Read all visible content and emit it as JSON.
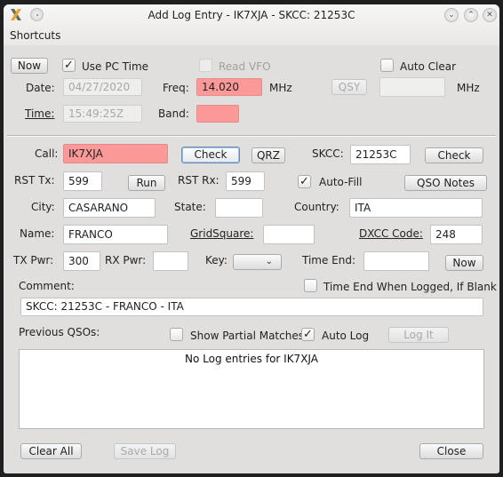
{
  "window": {
    "title": "Add Log Entry - IK7XJA - SKCC: 21253C",
    "icons": {
      "app": "x-app-icon",
      "pin": "pin-icon",
      "minimize": "chevron-down-icon",
      "maximize": "chevron-up-icon",
      "close": "close-icon"
    },
    "minimize_glyph": "⌄",
    "maximize_glyph": "⌃",
    "close_glyph": "✕"
  },
  "menu": {
    "items": [
      "Shortcuts"
    ]
  },
  "time_section": {
    "now_button": "Now",
    "use_pc_time": {
      "label": "Use PC Time",
      "checked": true,
      "glyph": "✓"
    },
    "read_vfo": {
      "label": "Read VFO",
      "checked": false,
      "disabled": true
    },
    "auto_clear": {
      "label": "Auto Clear",
      "checked": false
    },
    "date_label": "Date:",
    "date_value": "04/27/2020",
    "time_label": "Time:",
    "time_value": "15:49:25Z",
    "freq_label": "Freq:",
    "freq_value": "14.020",
    "freq_unit": "MHz",
    "band_label": "Band:",
    "band_value": "",
    "qsy_button": "QSY",
    "qsy_value": "",
    "qsy_unit": "MHz"
  },
  "contact": {
    "call_label": "Call:",
    "call_value": "IK7XJA",
    "check_button": "Check",
    "qrz_button": "QRZ",
    "skcc_label": "SKCC:",
    "skcc_value": "21253C",
    "skcc_check_button": "Check",
    "rst_tx_label": "RST Tx:",
    "rst_tx_value": "599",
    "run_button": "Run",
    "rst_rx_label": "RST Rx:",
    "rst_rx_value": "599",
    "auto_fill": {
      "label": "Auto-Fill",
      "checked": true,
      "glyph": "✓"
    },
    "qso_notes_button": "QSO Notes",
    "city_label": "City:",
    "city_value": "CASARANO",
    "state_label": "State:",
    "state_value": "",
    "country_label": "Country:",
    "country_value": "ITA",
    "name_label": "Name:",
    "name_value": "FRANCO",
    "gridsquare_label": "GridSquare:",
    "gridsquare_value": "",
    "dxcc_label": "DXCC Code:",
    "dxcc_value": "248",
    "tx_pwr_label": "TX Pwr:",
    "tx_pwr_value": "300",
    "rx_pwr_label": "RX Pwr:",
    "rx_pwr_value": "",
    "key_label": "Key:",
    "key_value": "",
    "key_arrow": "⌄",
    "time_end_label": "Time End:",
    "time_end_value": "",
    "time_end_now_button": "Now"
  },
  "comment": {
    "label": "Comment:",
    "time_end_when_logged": {
      "label": "Time End When Logged, If Blank",
      "checked": false
    },
    "value": "SKCC: 21253C - FRANCO - ITA"
  },
  "previous_qsos": {
    "label": "Previous QSOs:",
    "show_partial_matches": {
      "label": "Show Partial Matches",
      "checked": false
    },
    "auto_log": {
      "label": "Auto Log",
      "checked": true,
      "glyph": "✓"
    },
    "log_it_button": "Log It",
    "empty_message": "No Log entries for IK7XJA"
  },
  "footer": {
    "clear_all_button": "Clear All",
    "save_log_button": "Save Log",
    "close_button": "Close"
  },
  "colors": {
    "required_field": "#fb9999",
    "background": "#e0dfdd"
  }
}
